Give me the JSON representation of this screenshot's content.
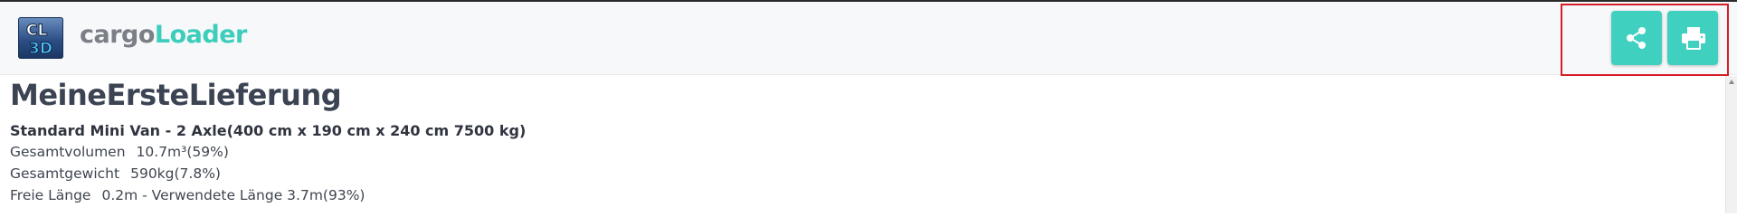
{
  "header": {
    "logo": {
      "icon": "cl3d-logo-icon",
      "text": "CL3D"
    },
    "brand": {
      "part1": "cargo",
      "part2": "Loader"
    },
    "actions": {
      "share_icon": "share-icon",
      "print_icon": "print-icon"
    }
  },
  "main": {
    "title": "MeineErsteLieferung",
    "vehicle": "Standard Mini Van - 2 Axle(400 cm x 190 cm x 240 cm 7500 kg)",
    "stats": [
      {
        "label": "Gesamtvolumen",
        "value": "10.7m³(59%)"
      },
      {
        "label": "Gesamtgewicht",
        "value": "590kg(7.8%)"
      },
      {
        "label": "Freie Länge",
        "value": "0.2m - Verwendete Länge   3.7m(93%)"
      }
    ]
  },
  "colors": {
    "accent": "#40d0c0",
    "brand_gray": "#7b7f86",
    "brand_teal": "#3ccdbb",
    "highlight": "#d51f28",
    "title": "#3c4454"
  }
}
